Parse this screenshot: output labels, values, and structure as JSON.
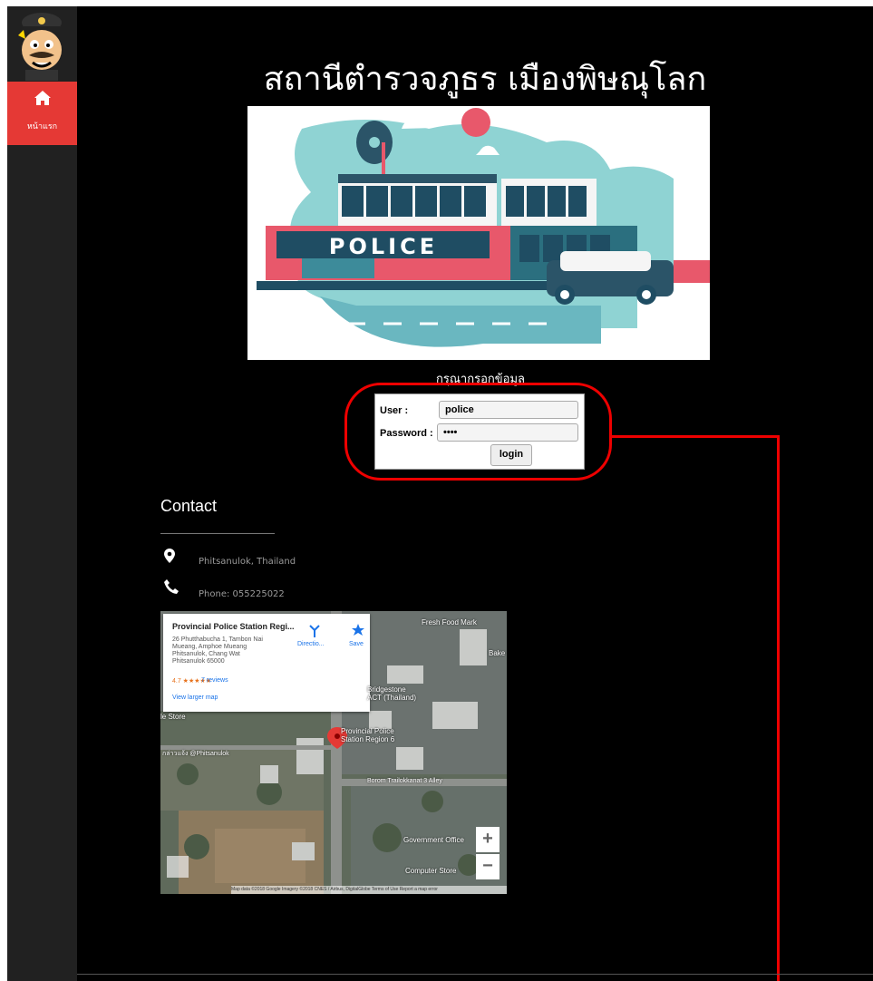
{
  "sidebar": {
    "home_label": "หน้าแรก",
    "home_icon": "home-icon"
  },
  "page": {
    "title": "สถานีตำรวจภูธร เมืองพิษณุโลก",
    "hero_sign": "POLICE",
    "prompt": "กรุณากรอกข้อมูล"
  },
  "login": {
    "user_label": "User :",
    "user_value": "police",
    "password_label": "Password :",
    "password_value": "••••",
    "button_label": "login"
  },
  "contact": {
    "title": "Contact",
    "location": "Phitsanulok, Thailand",
    "phone": "Phone: 055225022",
    "location_icon": "map-pin-icon",
    "phone_icon": "phone-icon"
  },
  "map": {
    "place_name": "Provincial Police Station Regi...",
    "address": "26 Phutthabucha 1, Tambon Nai\nMueang, Amphoe Mueang\nPhitsanulok, Chang Wat\nPhitsanulok 65000",
    "rating": "4.7 ★★★★★",
    "reviews": "7 reviews",
    "view_larger": "View larger map",
    "directions": "Directio...",
    "save": "Save",
    "labels": {
      "fresh_food": "Fresh Food Mark",
      "bridgestone": "Bridgestone\nACT (Thailand)",
      "store": "le Store",
      "station": "Provincial Police\nStation Region 6",
      "phitsanulok": "กล่าวแจ้ง @Phitsanulok",
      "borom": "Borom Trailokkanat 3 Alley",
      "gov": "Government Office",
      "computer": "Computer Store",
      "bake": "Bake"
    },
    "zoom_in": "+",
    "zoom_out": "−",
    "footer": "Map data ©2018 Google Imagery ©2018 CNES / Airbus, DigitalGlobe   Terms of Use   Report a map error"
  }
}
